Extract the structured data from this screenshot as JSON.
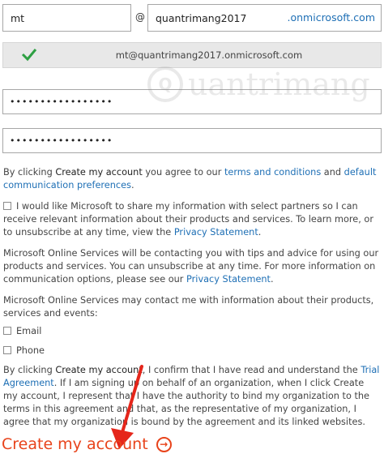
{
  "signup": {
    "username_value": "mt",
    "at_symbol": "@",
    "domain_value": "quantrimang2017",
    "domain_suffix": ".onmicrosoft.com",
    "resolved_address": "mt@quantrimang2017.onmicrosoft.com",
    "password_mask": "•••••••••••••••••",
    "confirm_password_mask": "•••••••••••••••••"
  },
  "terms": {
    "prefix": "By clicking ",
    "button_ref": "Create my account",
    "middle": " you agree to our ",
    "terms_link": "terms and conditions",
    "and": " and ",
    "prefs_link": "default communication preferences",
    "end": "."
  },
  "partners_optin": {
    "text": "I would like Microsoft to share my information with select partners so I can receive relevant information about their products and services. To learn more, or to unsubscribe at any time, view the ",
    "link": "Privacy Statement",
    "end": "."
  },
  "contact_notice": {
    "text": "Microsoft Online Services will be contacting you with tips and advice for using our products and services. You can unsubscribe at any time. For more information on communication options, please see our ",
    "link": "Privacy Statement",
    "end": "."
  },
  "contact_options": {
    "text": "Microsoft Online Services may contact me with information about their products, services and events:",
    "email_label": "Email",
    "phone_label": "Phone"
  },
  "agreement": {
    "prefix": "By clicking ",
    "button_ref": "Create my account",
    "middle": ", I confirm that I have read and understand the ",
    "trial_link": "Trial Agreement",
    "rest": ". If I am signing up on behalf of an organization, when I click Create my account, I represent that I have the authority to bind my organization to the terms in this agreement and that, as the representative of my organization, I agree that my organization is bound by the agreement and its linked websites."
  },
  "create_button": {
    "label": "Create my account",
    "icon": "arrow-circle-right-icon"
  },
  "watermark": {
    "text": "uantrimang",
    "logo_glyph": "Q"
  },
  "colors": {
    "link": "#1e6fb5",
    "accent": "#e8431b",
    "check": "#2ea043",
    "status_bg": "#e8e8e8"
  }
}
